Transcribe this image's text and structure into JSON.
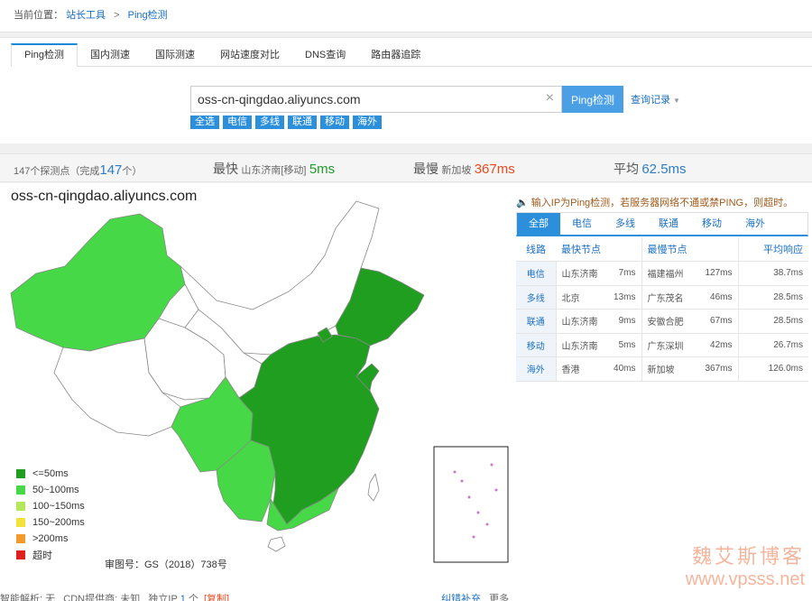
{
  "breadcrumb": {
    "prefix": "当前位置：",
    "link": "站长工具",
    "sep": ">",
    "current": "Ping检测"
  },
  "tabs": [
    "Ping检测",
    "国内测速",
    "国际测速",
    "网站速度对比",
    "DNS查询",
    "路由器追踪"
  ],
  "search": {
    "value": "oss-cn-qingdao.aliyuncs.com",
    "clear": "×",
    "button": "Ping检测",
    "history": "查询记录",
    "history_caret": "▼"
  },
  "filters": [
    "全选",
    "电信",
    "多线",
    "联通",
    "移动",
    "海外"
  ],
  "stats": {
    "probe_prefix": "147个探测点（完成",
    "probe_done": "147",
    "probe_suffix": "个）",
    "fastest_label": "最快",
    "fastest_loc": "山东济南[移动]",
    "fastest_val": "5ms",
    "slowest_label": "最慢",
    "slowest_loc": "新加坡",
    "slowest_val": "367ms",
    "avg_label": "平均",
    "avg_val": "62.5ms"
  },
  "map": {
    "title": "oss-cn-qingdao.aliyuncs.com",
    "map_no": "审图号：GS（2018）738号",
    "legend": [
      {
        "label": "<=50ms",
        "color": "#1f9e1f"
      },
      {
        "label": "50~100ms",
        "color": "#46d846"
      },
      {
        "label": "100~150ms",
        "color": "#b3e85a"
      },
      {
        "label": "150~200ms",
        "color": "#f2e23a"
      },
      {
        "label": ">200ms",
        "color": "#f39a2a"
      },
      {
        "label": "超时",
        "color": "#e0201a"
      }
    ]
  },
  "footer": {
    "resolve": "智能解析: 无",
    "cdn": "CDN提供商: 未知",
    "ip_label": "独立IP",
    "ip_count": "1",
    "ip_unit": "个",
    "copy": "[复制]",
    "feedback": "纠错补充",
    "more": "更多"
  },
  "notice": "输入IP为Ping检测，若服务器网络不通或禁PING，则超时。",
  "result_tabs": [
    "全部",
    "电信",
    "多线",
    "联通",
    "移动",
    "海外"
  ],
  "table": {
    "headers": [
      "线路",
      "最快节点",
      "最慢节点",
      "平均响应"
    ],
    "rows": [
      {
        "line": "电信",
        "fast": "山东济南",
        "fast_ms": "7ms",
        "slow": "福建福州",
        "slow_ms": "127ms",
        "avg": "38.7ms"
      },
      {
        "line": "多线",
        "fast": "北京",
        "fast_ms": "13ms",
        "slow": "广东茂名",
        "slow_ms": "46ms",
        "avg": "28.5ms"
      },
      {
        "line": "联通",
        "fast": "山东济南",
        "fast_ms": "9ms",
        "slow": "安徽合肥",
        "slow_ms": "67ms",
        "avg": "28.5ms"
      },
      {
        "line": "移动",
        "fast": "山东济南",
        "fast_ms": "5ms",
        "slow": "广东深圳",
        "slow_ms": "42ms",
        "avg": "26.7ms"
      },
      {
        "line": "海外",
        "fast": "香港",
        "fast_ms": "40ms",
        "slow": "新加坡",
        "slow_ms": "367ms",
        "avg": "126.0ms"
      }
    ]
  },
  "watermark": {
    "line1": "魏艾斯博客",
    "line2": "www.vpsss.net"
  }
}
